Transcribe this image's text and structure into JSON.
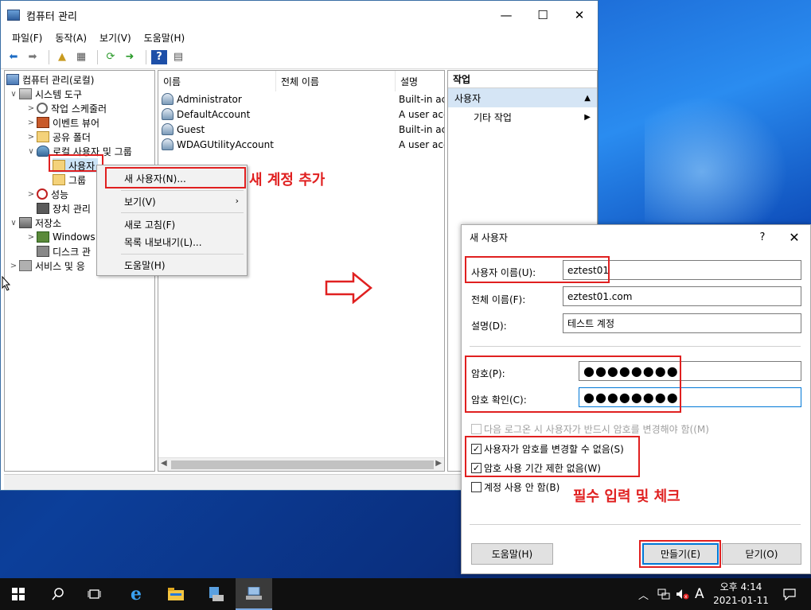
{
  "window": {
    "title": "컴퓨터 관리",
    "minimize": "—",
    "maximize": "☐",
    "close": "✕"
  },
  "menu": [
    "파일(F)",
    "동작(A)",
    "보기(V)",
    "도움말(H)"
  ],
  "tree": [
    {
      "label": "컴퓨터 관리(로컬)",
      "exp": "",
      "icon": "computer-management-icon"
    },
    {
      "label": "시스템 도구",
      "exp": "∨",
      "icon": "system-tools-icon"
    },
    {
      "label": "작업 스케줄러",
      "exp": ">",
      "icon": "task-scheduler-icon"
    },
    {
      "label": "이벤트 뷰어",
      "exp": ">",
      "icon": "event-viewer-icon"
    },
    {
      "label": "공유 폴더",
      "exp": ">",
      "icon": "shared-folder-icon"
    },
    {
      "label": "로컬 사용자 및 그룹",
      "exp": "∨",
      "icon": "local-users-groups-icon"
    },
    {
      "label": "사용자",
      "exp": "",
      "icon": "users-folder-icon"
    },
    {
      "label": "그룹",
      "exp": "",
      "icon": "groups-folder-icon"
    },
    {
      "label": "성능",
      "exp": ">",
      "icon": "performance-icon"
    },
    {
      "label": "장치 관리",
      "exp": "",
      "icon": "device-manager-icon"
    },
    {
      "label": "저장소",
      "exp": "∨",
      "icon": "storage-icon"
    },
    {
      "label": "Windows",
      "exp": ">",
      "icon": "windows-backup-icon"
    },
    {
      "label": "디스크 관",
      "exp": "",
      "icon": "disk-management-icon"
    },
    {
      "label": "서비스 및 응",
      "exp": ">",
      "icon": "services-icon"
    }
  ],
  "list": {
    "columns": [
      "이름",
      "전체 이름",
      "설명"
    ],
    "rows": [
      {
        "name": "Administrator",
        "desc": "Built-in ac"
      },
      {
        "name": "DefaultAccount",
        "desc": "A user acc"
      },
      {
        "name": "Guest",
        "desc": "Built-in ac"
      },
      {
        "name": "WDAGUtilityAccount",
        "desc": "A user acc"
      }
    ]
  },
  "actions": {
    "header": "작업",
    "selected": "사용자",
    "more": "기타 작업"
  },
  "context_menu": {
    "new_user": "새 사용자(N)...",
    "view": "보기(V)",
    "refresh": "새로 고침(F)",
    "export": "목록 내보내기(L)...",
    "help": "도움말(H)"
  },
  "annotations": {
    "add_account": "새 계정 추가",
    "required": "필수 입력 및 체크"
  },
  "dialog": {
    "title": "새 사용자",
    "help_glyph": "?",
    "close_glyph": "✕",
    "username_label": "사용자 이름(U):",
    "username_value": "eztest01",
    "fullname_label": "전체 이름(F):",
    "fullname_value": "eztest01.com",
    "desc_label": "설명(D):",
    "desc_value": "테스트 계정",
    "password_label": "암호(P):",
    "password_value": "●●●●●●●●",
    "confirm_label": "암호 확인(C):",
    "confirm_value": "●●●●●●●●",
    "chk_must_change": "다음 로그온 시 사용자가 반드시 암호를 변경해야 함((M)",
    "chk_cannot_change": "사용자가 암호를 변경할 수 없음(S)",
    "chk_never_expires": "암호 사용 기간 제한 없음(W)",
    "chk_disabled": "계정 사용 안 함(B)",
    "help_button": "도움말(H)",
    "create_button": "만들기(E)",
    "close_button": "닫기(O)"
  },
  "taskbar": {
    "time": "오후 4:14",
    "date": "2021-01-11",
    "ime": "A"
  }
}
